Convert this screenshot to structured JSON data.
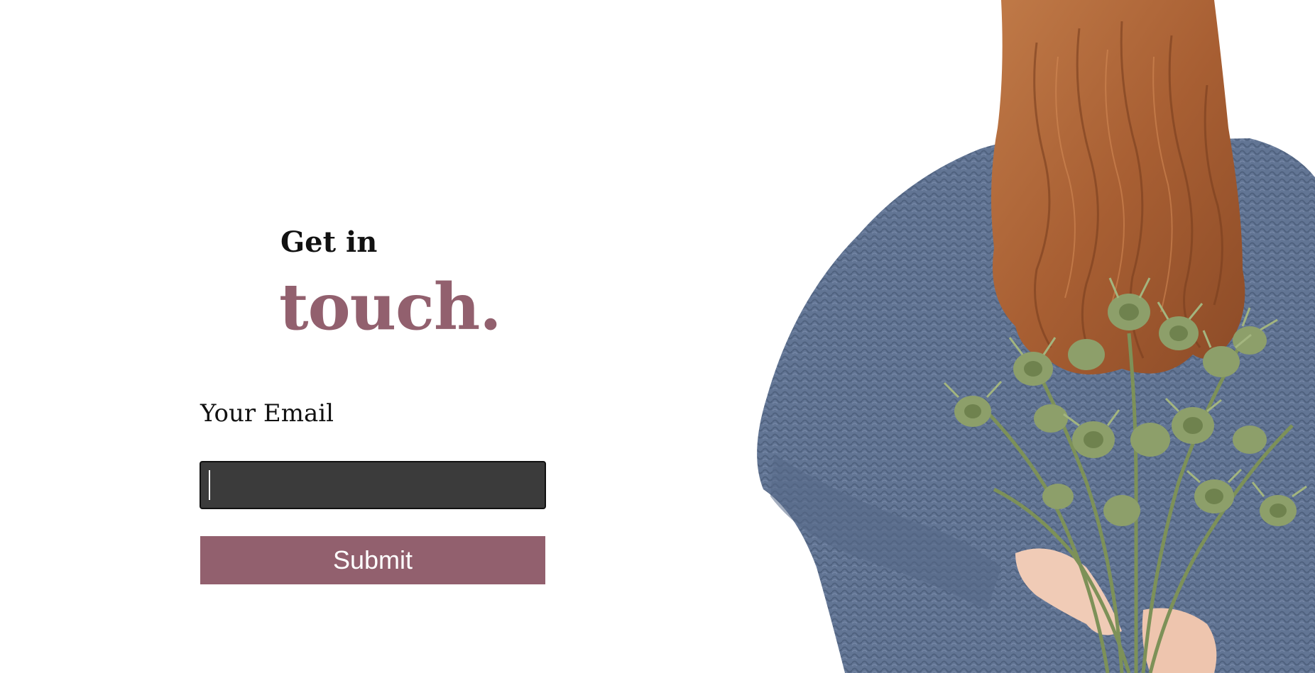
{
  "hero": {
    "heading_small": "Get in",
    "heading_large": "touch."
  },
  "form": {
    "email_label": "Your Email",
    "email_value": "",
    "email_placeholder": "",
    "submit_label": "Submit"
  },
  "colors": {
    "accent": "#92606e",
    "input_bg": "#3b3b3b",
    "sweater": "#627594",
    "hair": "#b0693a",
    "bouquet": "#8d9f6a"
  },
  "image": {
    "subject": "woman-with-flowers-photo"
  }
}
